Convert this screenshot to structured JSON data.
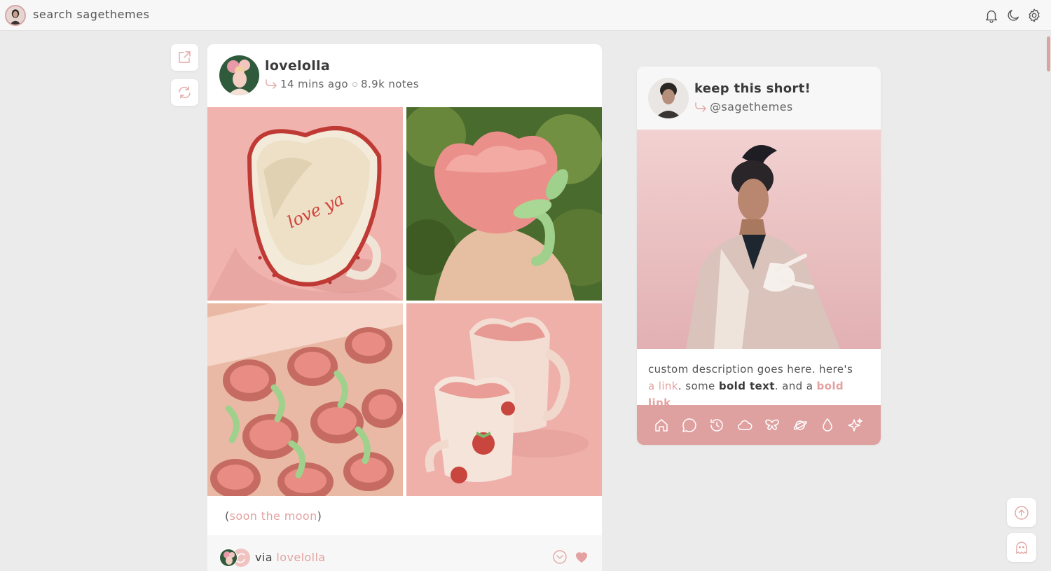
{
  "topbar": {
    "search_text": "search sagethemes",
    "icons": [
      "bell-icon",
      "moon-icon",
      "gear-icon"
    ]
  },
  "side_actions": [
    "external-link-icon",
    "reblog-icon"
  ],
  "post": {
    "username": "lovelolla",
    "time": "14 mins ago",
    "notes": "8.9k notes",
    "caption_open": "(",
    "caption_link": "soon the moon",
    "caption_close": ")",
    "via_label": "via",
    "via_user": "lovelolla",
    "photo_lettering": "love ya"
  },
  "sidebar": {
    "title": "keep this short!",
    "handle": "@sagethemes",
    "desc_1": "custom description goes here. here's",
    "desc_link": "a link",
    "desc_2": ". some",
    "desc_bold": "bold text",
    "desc_3": ". and a",
    "desc_bold_link": "bold link",
    "desc_4": ".",
    "nav_icons": [
      "home-icon",
      "chat-icon",
      "history-icon",
      "cloud-icon",
      "butterfly-icon",
      "planet-icon",
      "droplet-icon",
      "sparkle-icon"
    ]
  },
  "floating": [
    "scroll-top-icon",
    "ghost-icon"
  ],
  "colors": {
    "accent": "#dfa0a0",
    "link": "#e3a2a0",
    "background": "#ebebeb"
  }
}
